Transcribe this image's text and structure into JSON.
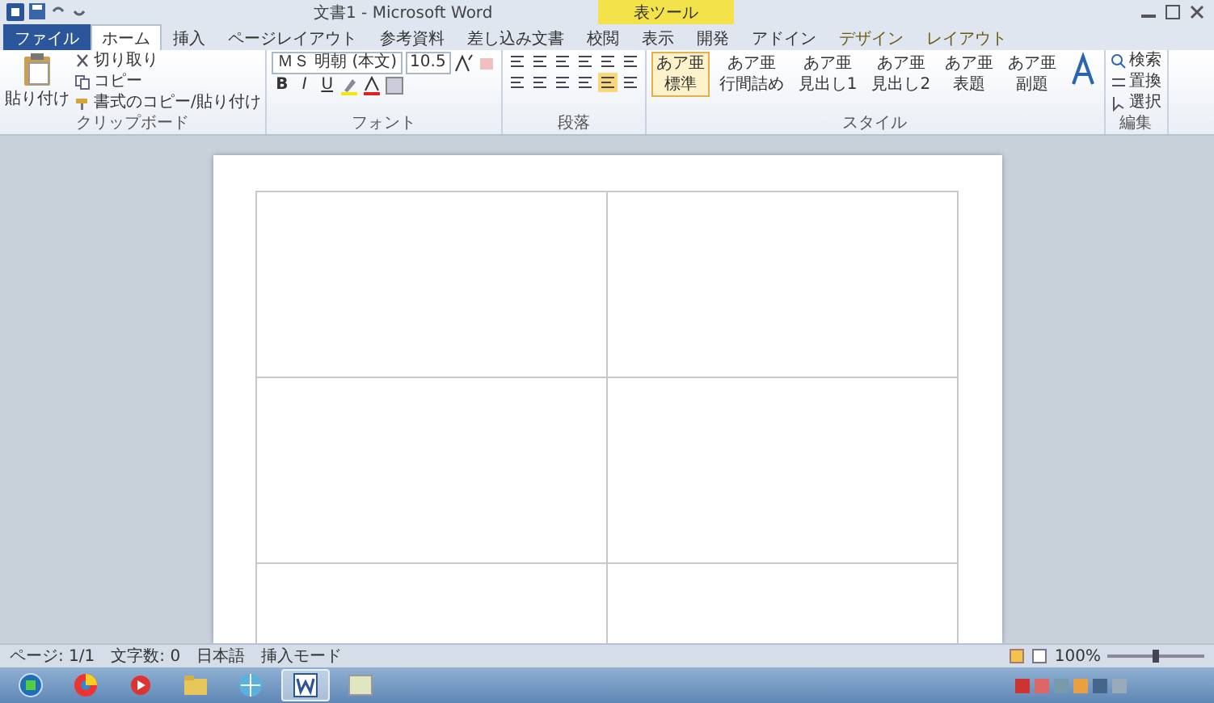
{
  "window": {
    "title": "文書1 - Microsoft Word",
    "context_group": "表ツール"
  },
  "tabs": [
    {
      "label": "ファイル",
      "kind": "file",
      "selected": false
    },
    {
      "label": "ホーム",
      "kind": "main",
      "selected": true
    },
    {
      "label": "挿入",
      "kind": "main",
      "selected": false
    },
    {
      "label": "ページレイアウト",
      "kind": "main",
      "selected": false
    },
    {
      "label": "参考資料",
      "kind": "main",
      "selected": false
    },
    {
      "label": "差し込み文書",
      "kind": "main",
      "selected": false
    },
    {
      "label": "校閲",
      "kind": "main",
      "selected": false
    },
    {
      "label": "表示",
      "kind": "main",
      "selected": false
    },
    {
      "label": "開発",
      "kind": "main",
      "selected": false
    },
    {
      "label": "アドイン",
      "kind": "main",
      "selected": false
    },
    {
      "label": "デザイン",
      "kind": "context",
      "selected": false
    },
    {
      "label": "レイアウト",
      "kind": "context",
      "selected": false
    }
  ],
  "ribbon": {
    "clipboard": {
      "paste": "貼り付け",
      "items": [
        "切り取り",
        "コピー",
        "書式のコピー/貼り付け"
      ],
      "label": "クリップボード"
    },
    "font": {
      "name": "ＭＳ 明朝 (本文)",
      "size": "10.5",
      "buttons": [
        "B",
        "I",
        "U"
      ],
      "label": "フォント"
    },
    "paragraph": {
      "label": "段落"
    },
    "styles": {
      "items": [
        {
          "sample": "あア亜",
          "name": "標準",
          "selected": true
        },
        {
          "sample": "あア亜",
          "name": "行間詰め",
          "selected": false
        },
        {
          "sample": "あア亜",
          "name": "見出し1",
          "selected": false
        },
        {
          "sample": "あア亜",
          "name": "見出し2",
          "selected": false
        },
        {
          "sample": "あア亜",
          "name": "表題",
          "selected": false
        },
        {
          "sample": "あア亜",
          "name": "副題",
          "selected": false
        }
      ],
      "label": "スタイル"
    },
    "editing": {
      "items": [
        "検索",
        "置換",
        "選択"
      ],
      "label": "編集"
    }
  },
  "status_bar": {
    "page": "ページ: 1/1",
    "words": "文字数: 0",
    "language": "日本語",
    "mode": "挿入モード",
    "zoom": "100%",
    "zoom_slider": {
      "level": 0.5
    }
  },
  "taskbar": {
    "apps": [
      {
        "kind": "start",
        "selected": false
      },
      {
        "kind": "browser",
        "selected": false
      },
      {
        "kind": "media",
        "selected": false
      },
      {
        "kind": "folder",
        "selected": false
      },
      {
        "kind": "explorer",
        "selected": false
      },
      {
        "kind": "word",
        "selected": true
      },
      {
        "kind": "app",
        "selected": false
      }
    ]
  }
}
